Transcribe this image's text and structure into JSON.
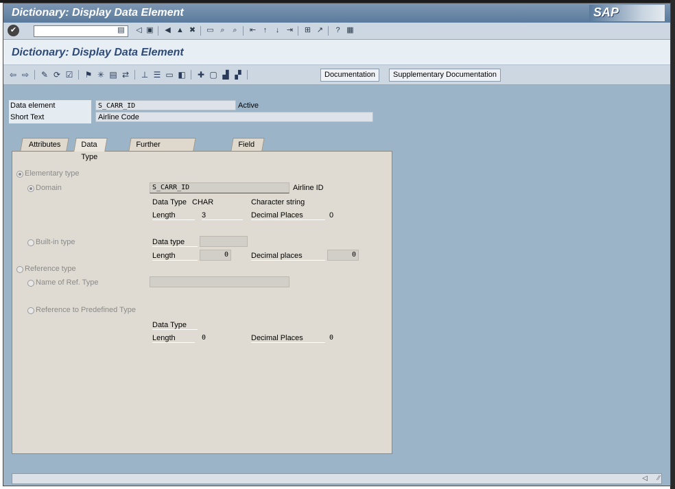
{
  "window": {
    "title": "Dictionary: Display Data Element",
    "logo": "SAP"
  },
  "systoolbar": {
    "icons": [
      "ok-icon",
      "save-icon",
      "back-icon",
      "exit-icon",
      "cancel-icon",
      "print-icon",
      "find-icon",
      "find-next-icon",
      "first-page-icon",
      "prev-page-icon",
      "next-page-icon",
      "last-page-icon",
      "new-session-icon",
      "shortcut-icon",
      "help-icon",
      "layout-icon"
    ]
  },
  "app": {
    "title": "Dictionary: Display Data Element",
    "buttons": {
      "documentation": "Documentation",
      "supp_documentation": "Supplementary Documentation"
    }
  },
  "header": {
    "data_element_label": "Data element",
    "data_element_value": "S_CARR_ID",
    "status": "Active",
    "short_text_label": "Short Text",
    "short_text_value": "Airline Code"
  },
  "tabs": [
    {
      "label": "Attributes",
      "active": false
    },
    {
      "label": "Data Type",
      "active": true
    },
    {
      "label": "Further Characteristics",
      "active": false
    },
    {
      "label": "Field label",
      "active": false
    }
  ],
  "datatype": {
    "elementary_type": "Elementary type",
    "domain": "Domain",
    "domain_value": "S_CARR_ID",
    "domain_desc": "Airline ID",
    "dt_label": "Data Type",
    "dt_value": "CHAR",
    "dt_desc": "Character string",
    "len_label": "Length",
    "len_value": "3",
    "dec_label": "Decimal Places",
    "dec_value": "0",
    "builtin_type": "Built-in type",
    "bi_dt_label": "Data type",
    "bi_len_label": "Length",
    "bi_len_value": "0",
    "bi_dec_label": "Decimal places",
    "bi_dec_value": "0",
    "reference_type": "Reference type",
    "name_ref_type": "Name of Ref. Type",
    "ref_predefined": "Reference to Predefined Type",
    "rp_dt_label": "Data Type",
    "rp_len_label": "Length",
    "rp_len_value": "0",
    "rp_dec_label": "Decimal Places",
    "rp_dec_value": "0"
  }
}
